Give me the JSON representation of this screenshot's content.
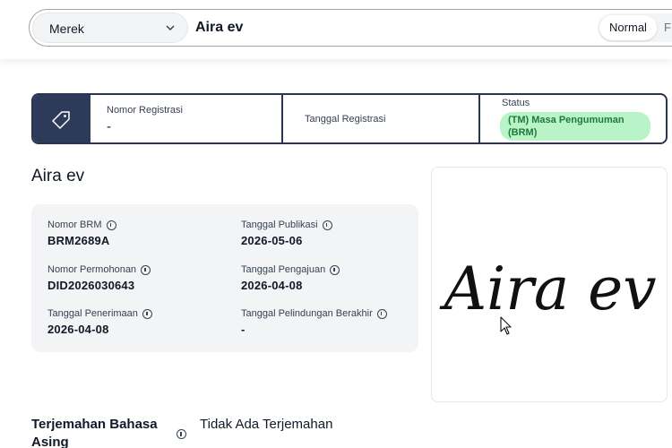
{
  "search": {
    "category_select": "Merek",
    "query": "Aira ev",
    "mode_active": "Normal",
    "mode_next": "F"
  },
  "registration": {
    "number_label": "Nomor Registrasi",
    "number_value": "-",
    "date_label": "Tanggal Registrasi",
    "status_label": "Status",
    "status_value": "(TM) Masa Pengumuman (BRM)"
  },
  "trademark": {
    "title": "Aira ev",
    "logo_text": "Aira ev"
  },
  "details": [
    {
      "label": "Nomor BRM",
      "value": "BRM2689A"
    },
    {
      "label": "Tanggal Publikasi",
      "value": "2026-05-06"
    },
    {
      "label": "Nomor Permohonan",
      "value": "DID2026030643"
    },
    {
      "label": "Tanggal Pengajuan",
      "value": "2026-04-08"
    },
    {
      "label": "Tanggal Penerimaan",
      "value": "2026-04-08"
    },
    {
      "label": "Tanggal Pelindungan Berakhir",
      "value": "-"
    }
  ],
  "translation": {
    "label": "Terjemahan Bahasa Asing",
    "value": "Tidak Ada Terjemahan"
  },
  "colors": {
    "primary_navy": "#2e3a5a",
    "status_green_bg": "#b9f3c8",
    "status_green_text": "#1f7a3a",
    "card_gray": "#f3f4f6"
  }
}
